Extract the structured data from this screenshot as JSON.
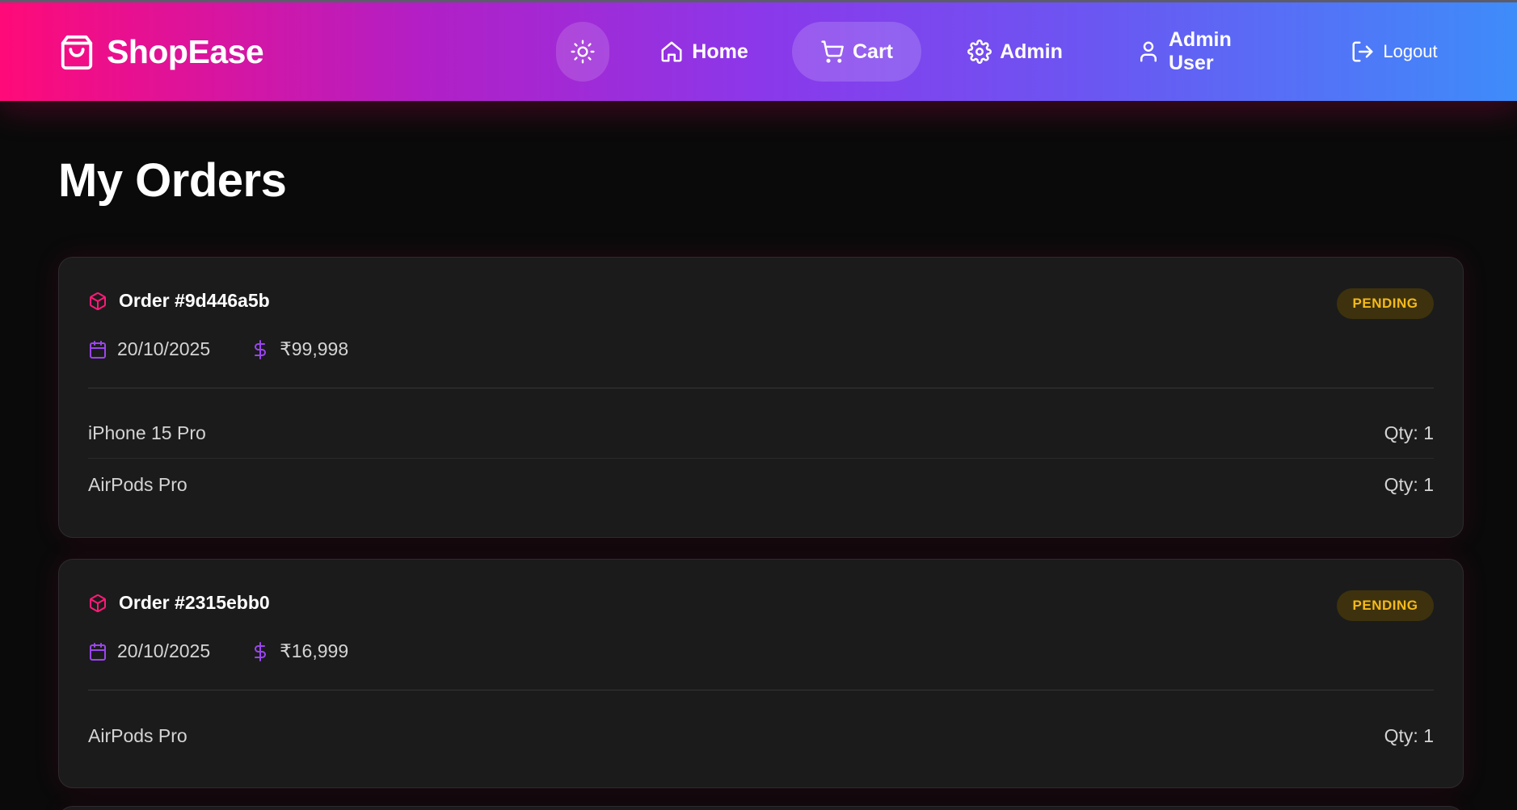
{
  "brand": {
    "name": "ShopEase"
  },
  "nav": {
    "home": "Home",
    "cart": "Cart",
    "admin": "Admin",
    "user": "Admin User",
    "logout": "Logout"
  },
  "page": {
    "title": "My Orders"
  },
  "orders": [
    {
      "id": "Order #9d446a5b",
      "status": "PENDING",
      "date": "20/10/2025",
      "total": "₹99,998",
      "items": [
        {
          "name": "iPhone 15 Pro",
          "qty": "Qty: 1"
        },
        {
          "name": "AirPods Pro",
          "qty": "Qty: 1"
        }
      ]
    },
    {
      "id": "Order #2315ebb0",
      "status": "PENDING",
      "date": "20/10/2025",
      "total": "₹16,999",
      "items": [
        {
          "name": "AirPods Pro",
          "qty": "Qty: 1"
        }
      ]
    }
  ],
  "colors": {
    "accent_pink": "#ff0a78",
    "accent_purple": "#8b38ea",
    "accent_blue": "#3e8cfa",
    "status_pending_text": "#f6b91a",
    "status_pending_bg": "#3d320d",
    "card_bg": "#1b1b1b",
    "page_bg": "#0a0a0a"
  },
  "icons": {
    "brand": "shopping-bag-icon",
    "theme": "sun-icon",
    "home": "home-icon",
    "cart": "cart-icon",
    "admin": "gear-icon",
    "user": "user-icon",
    "logout": "logout-icon",
    "order": "package-icon",
    "date": "calendar-icon",
    "total": "dollar-icon"
  }
}
